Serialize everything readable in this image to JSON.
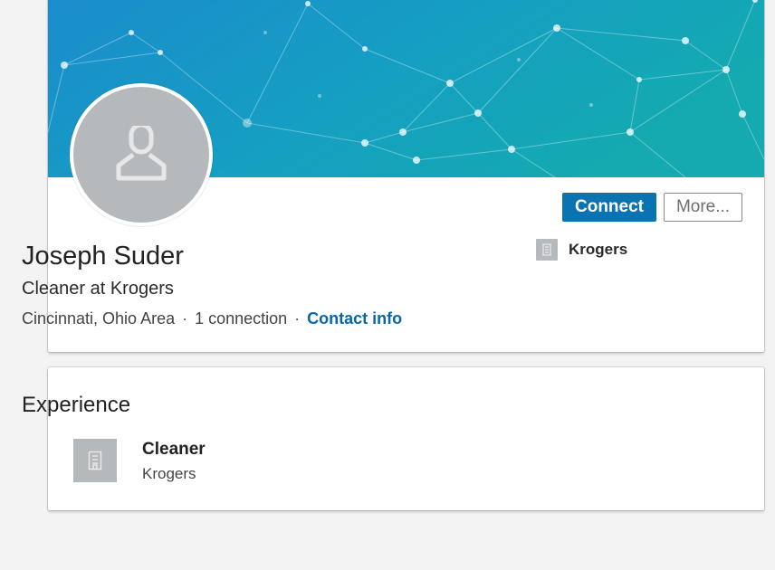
{
  "profile": {
    "name": "Joseph Suder",
    "headline": "Cleaner at Krogers",
    "location": "Cincinnati, Ohio Area",
    "separator": "·",
    "connections": "1 connection",
    "contact_info": "Contact info",
    "current_company": "Krogers",
    "avatar_icon": "person-icon"
  },
  "actions": {
    "connect_label": "Connect",
    "more_label": "More..."
  },
  "experience": {
    "title": "Experience",
    "items": [
      {
        "role": "Cleaner",
        "company": "Krogers",
        "icon": "building-icon"
      }
    ]
  },
  "colors": {
    "banner_start": "#1a8fc8",
    "banner_end": "#12a8b0",
    "primary_button": "#0a73b1",
    "link": "#0a66a8",
    "placeholder_gray": "#b6b9bc",
    "page_background": "#f3f3f3"
  }
}
